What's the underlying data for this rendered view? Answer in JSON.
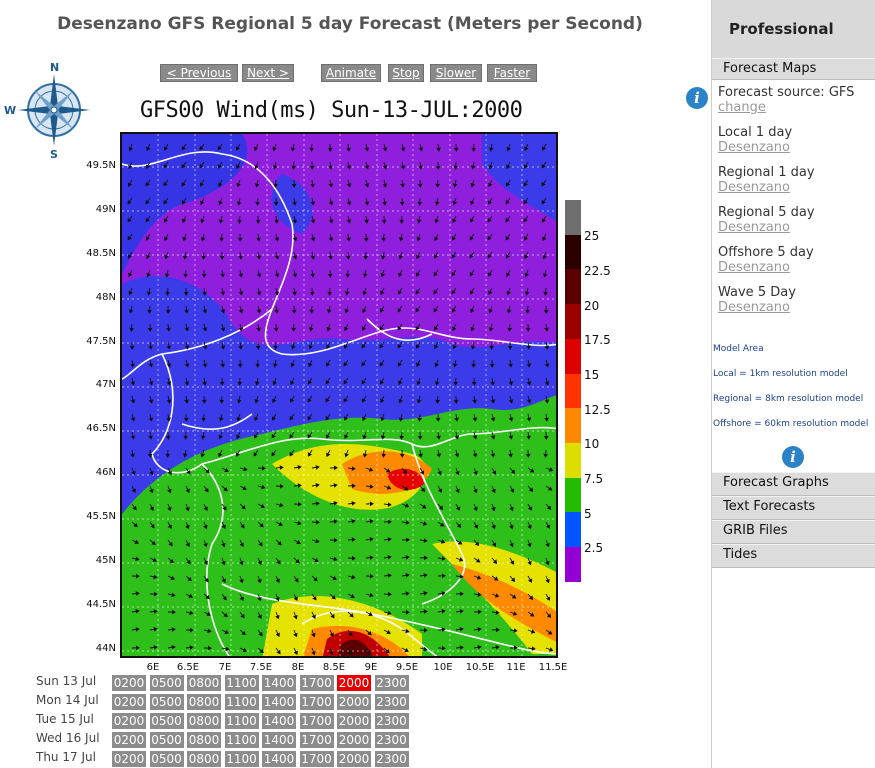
{
  "page_title": "Desenzano GFS Regional 5 day Forecast (Meters per Second)",
  "controls": {
    "previous": "< Previous",
    "next": "Next >",
    "animate": "Animate",
    "stop": "Stop",
    "slower": "Slower",
    "faster": "Faster"
  },
  "compass": {
    "n": "N",
    "s": "S",
    "w": "W"
  },
  "plot": {
    "title": "GFS00 Wind(ms) Sun-13-JUL:2000",
    "lat_labels": [
      "49.5N",
      "49N",
      "48.5N",
      "48N",
      "47.5N",
      "47N",
      "46.5N",
      "46N",
      "45.5N",
      "45N",
      "44.5N",
      "44N"
    ],
    "lon_labels": [
      "6E",
      "6.5E",
      "7E",
      "7.5E",
      "8E",
      "8.5E",
      "9E",
      "9.5E",
      "10E",
      "10.5E",
      "11E",
      "11.5E"
    ]
  },
  "colorbar": {
    "labels": [
      "25",
      "22.5",
      "20",
      "17.5",
      "15",
      "12.5",
      "10",
      "7.5",
      "5",
      "2.5"
    ],
    "colors": [
      "#6e6e6e",
      "#2a0000",
      "#5a0000",
      "#9b0000",
      "#dd0000",
      "#ff3300",
      "#ff8800",
      "#dddd00",
      "#22bb00",
      "#0055ff",
      "#9400d3"
    ]
  },
  "timetable": {
    "times": [
      "0200",
      "0500",
      "0800",
      "1100",
      "1400",
      "1700",
      "2000",
      "2300"
    ],
    "days": [
      "Sun 13 Jul",
      "Mon 14 Jul",
      "Tue 15 Jul",
      "Wed 16 Jul",
      "Thu 17 Jul"
    ],
    "active_day_index": 0,
    "active_time_index": 6
  },
  "sidebar": {
    "header": "Professional",
    "forecast_maps": "Forecast Maps",
    "source_label": "Forecast source: GFS",
    "source_change": "change",
    "items": [
      {
        "label": "Local 1 day",
        "link": "Desenzano"
      },
      {
        "label": "Regional 1 day",
        "link": "Desenzano"
      },
      {
        "label": "Regional 5 day",
        "link": "Desenzano"
      },
      {
        "label": "Offshore 5 day",
        "link": "Desenzano"
      },
      {
        "label": "Wave 5 Day",
        "link": "Desenzano"
      }
    ],
    "model_area": "Model Area",
    "notes": [
      "Local = 1km resolution model",
      "Regional = 8km resolution model",
      "Offshore = 60km resolution model"
    ],
    "bottom_bars": [
      "Forecast Graphs",
      "Text Forecasts",
      "GRIB Files",
      "Tides"
    ]
  }
}
